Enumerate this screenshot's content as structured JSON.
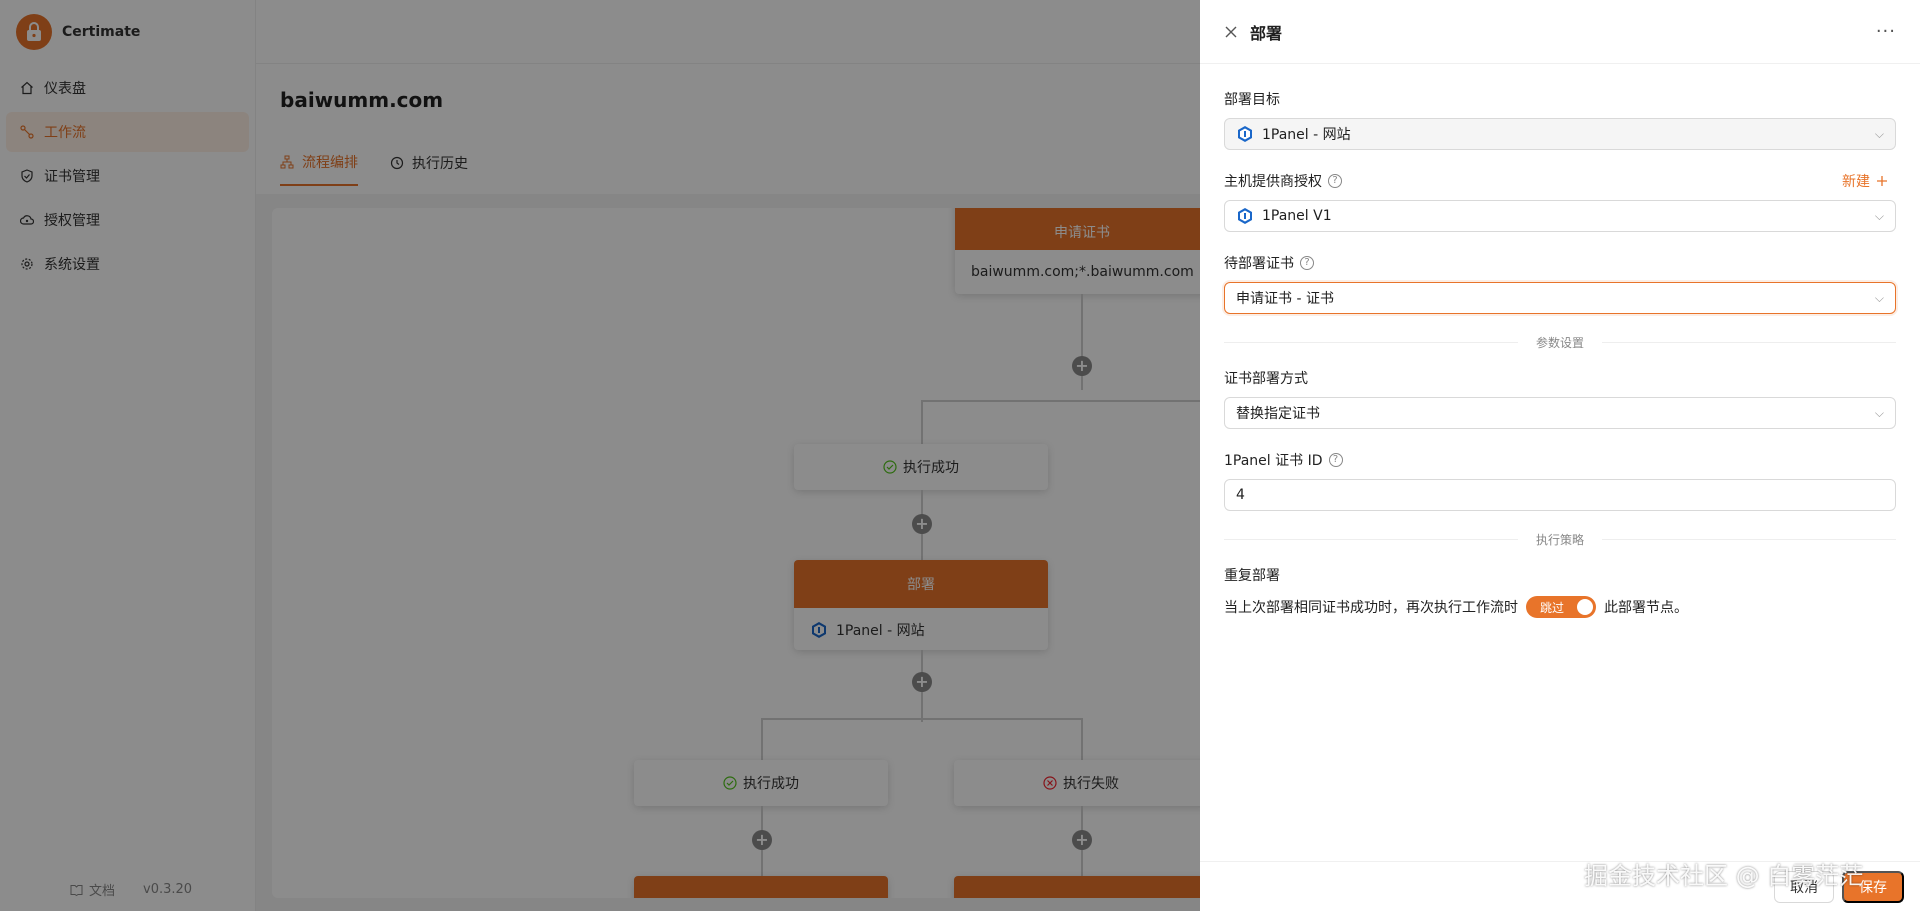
{
  "app": {
    "name": "Certimate",
    "version": "v0.3.20",
    "docs_label": "文档"
  },
  "sidebar": {
    "items": [
      {
        "label": "仪表盘",
        "icon": "home-icon"
      },
      {
        "label": "工作流",
        "icon": "workflow-icon"
      },
      {
        "label": "证书管理",
        "icon": "shield-check-icon"
      },
      {
        "label": "授权管理",
        "icon": "cloud-key-icon"
      },
      {
        "label": "系统设置",
        "icon": "gear-icon"
      }
    ],
    "active_index": 1
  },
  "page": {
    "title": "baiwumm.com",
    "tabs": [
      {
        "label": "流程编排"
      },
      {
        "label": "执行历史"
      }
    ]
  },
  "workflow": {
    "apply_node": {
      "title": "申请证书",
      "domains": "baiwumm.com;*.baiwumm.com"
    },
    "success_label": "执行成功",
    "failure_label": "执行失败",
    "deploy_node": {
      "title": "部署",
      "target": "1Panel - 网站"
    }
  },
  "drawer": {
    "title": "部署",
    "more_label": "···",
    "deploy_target": {
      "label": "部署目标",
      "value": "1Panel - 网站"
    },
    "provider_access": {
      "label": "主机提供商授权",
      "value": "1Panel V1",
      "new_label": "新建"
    },
    "certificate": {
      "label": "待部署证书",
      "value": "申请证书 - 证书"
    },
    "param_section": "参数设置",
    "deploy_mode": {
      "label": "证书部署方式",
      "value": "替换指定证书"
    },
    "panel_cert_id": {
      "label": "1Panel 证书 ID",
      "value": "4"
    },
    "strategy_section": "执行策略",
    "redeploy": {
      "label": "重复部署",
      "prefix": "当上次部署相同证书成功时，再次执行工作流时",
      "switch_label": "跳过",
      "suffix": "此部署节点。"
    },
    "cancel_label": "取消",
    "save_label": "保存"
  },
  "watermark": "掘金技术社区 @ 白雾茫茫",
  "colors": {
    "accent": "#e8742a",
    "overlay": "rgba(0,0,0,0.45)",
    "success": "#52c41a",
    "error": "#f5222d"
  }
}
